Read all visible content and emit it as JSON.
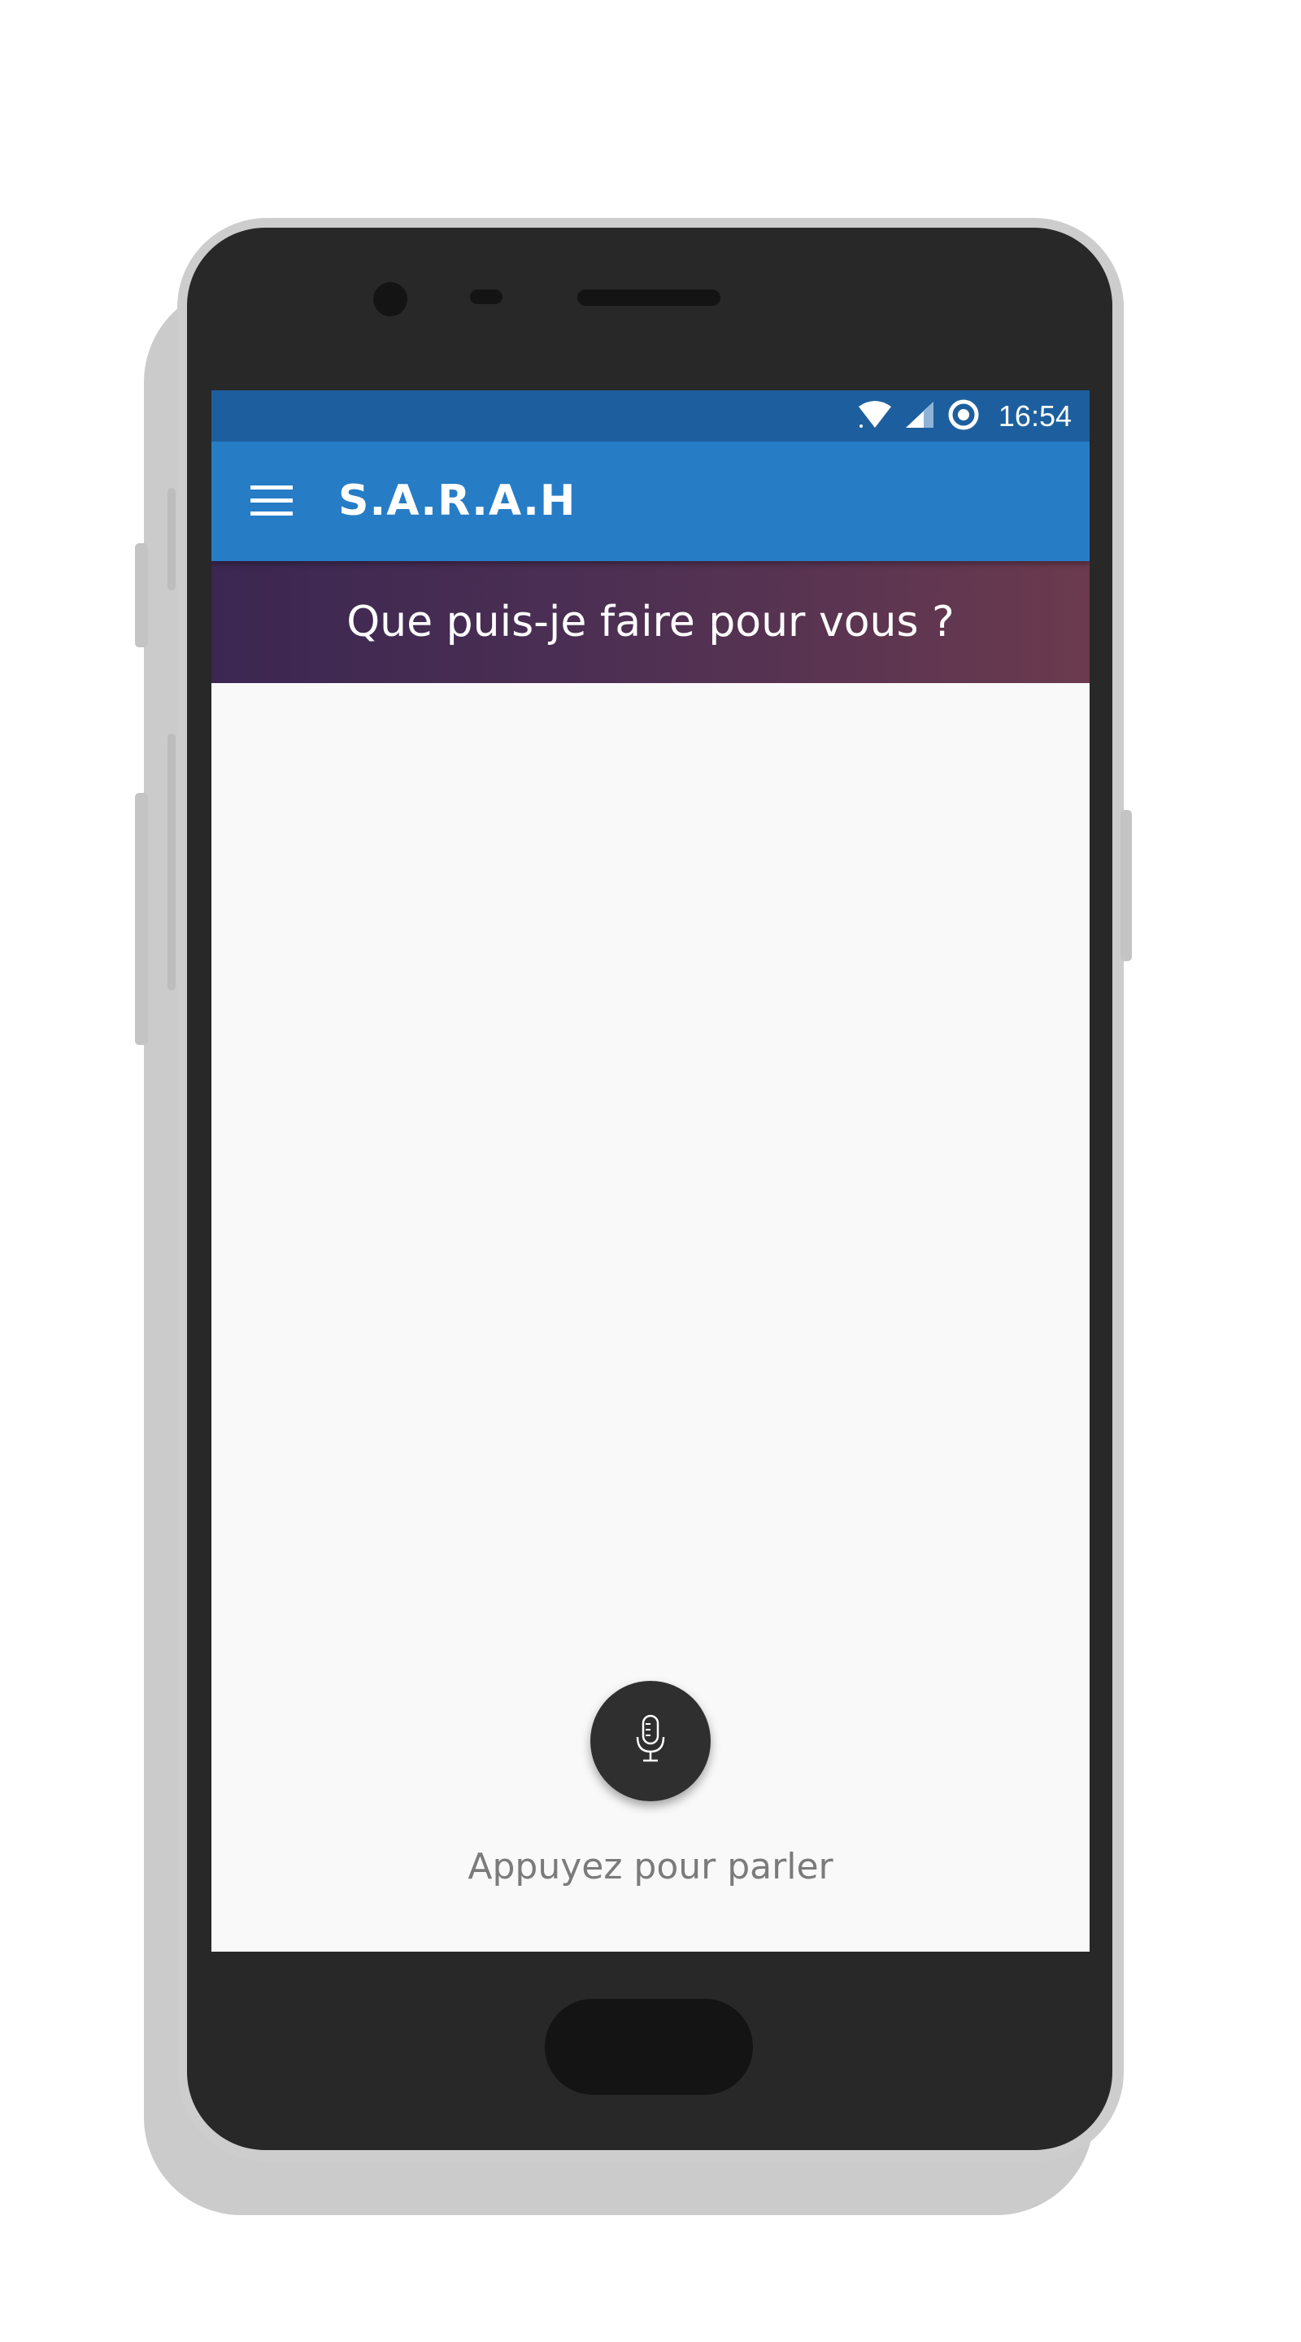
{
  "status_bar": {
    "time": "16:54",
    "icons": [
      "wifi-icon",
      "cellular-signal-icon",
      "data-saver-icon"
    ]
  },
  "app_bar": {
    "title": "S.A.R.A.H",
    "menu_icon": "hamburger-menu-icon",
    "color": "#267dc6"
  },
  "prompt": {
    "text": "Que puis-je faire pour vous ?"
  },
  "voice": {
    "icon": "microphone-icon",
    "label": "Appuyez pour parler"
  },
  "colors": {
    "status_bar": "#1d5f9e",
    "app_bar": "#267dc6",
    "banner_start": "#3b2752",
    "banner_end": "#6b3a4e",
    "mic_button": "#2f2f2f",
    "screen_background": "#f9f9f9"
  }
}
